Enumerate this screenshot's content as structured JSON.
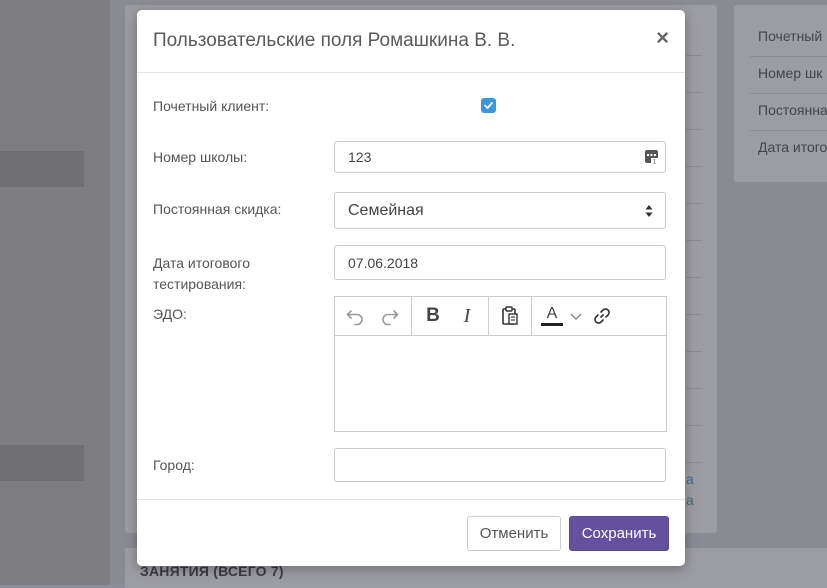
{
  "background": {
    "right_panel_items": [
      "Почетный",
      "Номер шк",
      "Постоянна",
      "Дата итого"
    ],
    "links": [
      "а",
      "а"
    ],
    "bottom_title": "ЗАНЯТИЯ (ВСЕГО 7)"
  },
  "modal": {
    "title": "Пользовательские поля Ромашкина В. В.",
    "close_glyph": "×",
    "fields": {
      "honorary_client": {
        "label": "Почетный клиент:",
        "checked": true
      },
      "school_number": {
        "label": "Номер школы:",
        "value": "123"
      },
      "discount": {
        "label": "Постоянная скидка:",
        "value": "Семейная"
      },
      "test_date": {
        "label": "Дата итогового тестирования:",
        "value": "07.06.2018"
      },
      "edo": {
        "label": "ЭДО:",
        "toolbar": {
          "bold": "B",
          "italic": "I",
          "text_color": "A"
        }
      },
      "city": {
        "label": "Город:",
        "value": ""
      }
    },
    "buttons": {
      "cancel": "Отменить",
      "save": "Сохранить"
    }
  },
  "colors": {
    "accent": "#63509e",
    "checkbox": "#3c96d8"
  }
}
